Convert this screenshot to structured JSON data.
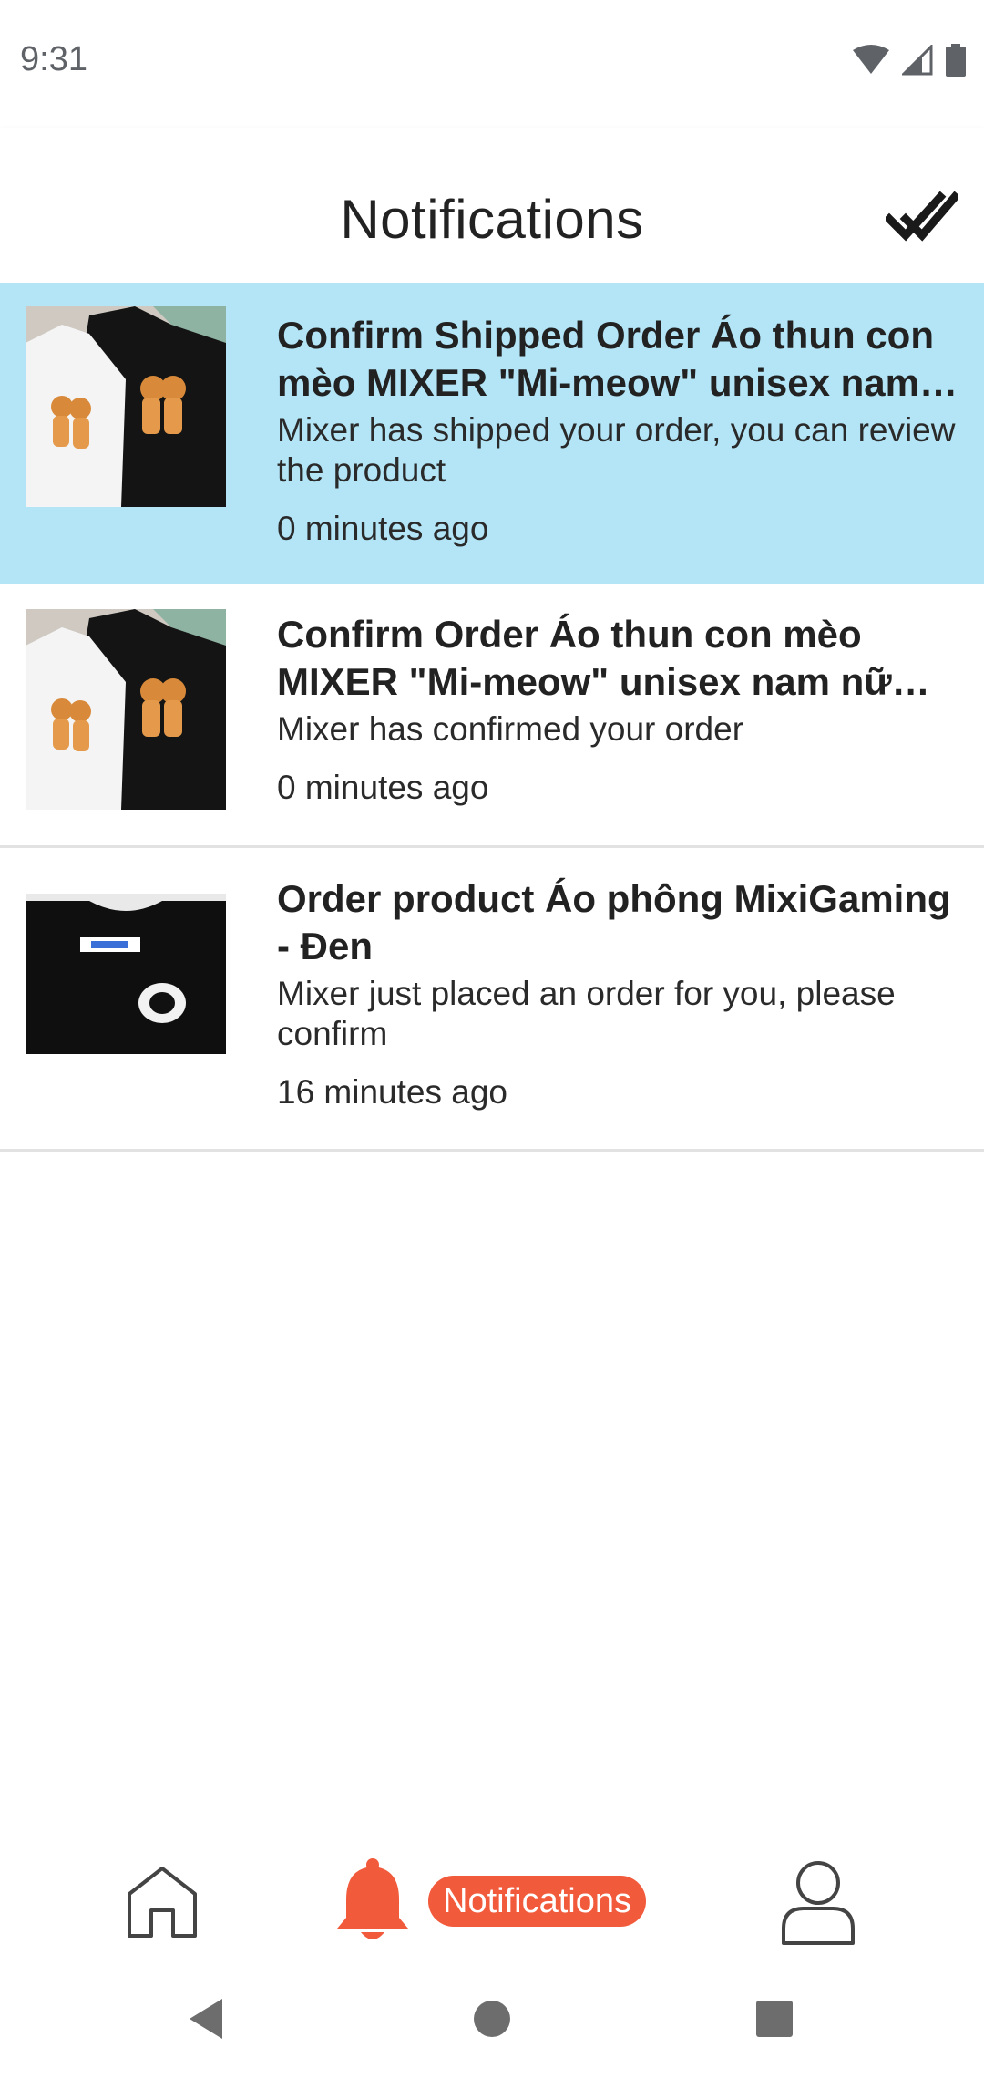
{
  "status_bar": {
    "time": "9:31"
  },
  "app_bar": {
    "title": "Notifications",
    "mark_all_icon": "double-check-icon"
  },
  "notifications": [
    {
      "title": "Confirm Shipped Order Áo thun con mèo MIXER \"Mi-meow\" unisex nam …",
      "body": "Mixer has shipped your order, you can review the product",
      "time": "0 minutes ago",
      "unread": true
    },
    {
      "title": "Confirm Order Áo thun con mèo MIXER \"Mi-meow\" unisex nam nữ ba…",
      "body": "Mixer has confirmed your order",
      "time": "0 minutes ago",
      "unread": false
    },
    {
      "title": "Order product Áo phông MixiGaming - Đen",
      "body": "Mixer just placed an order for you, please confirm",
      "time": "16 minutes ago",
      "unread": false
    }
  ],
  "bottom_nav": {
    "active_label": "Notifications",
    "items": [
      "home-icon",
      "bell-icon",
      "user-icon"
    ]
  },
  "colors": {
    "accent": "#f25a3c",
    "unread_bg": "#b3e5f7"
  }
}
